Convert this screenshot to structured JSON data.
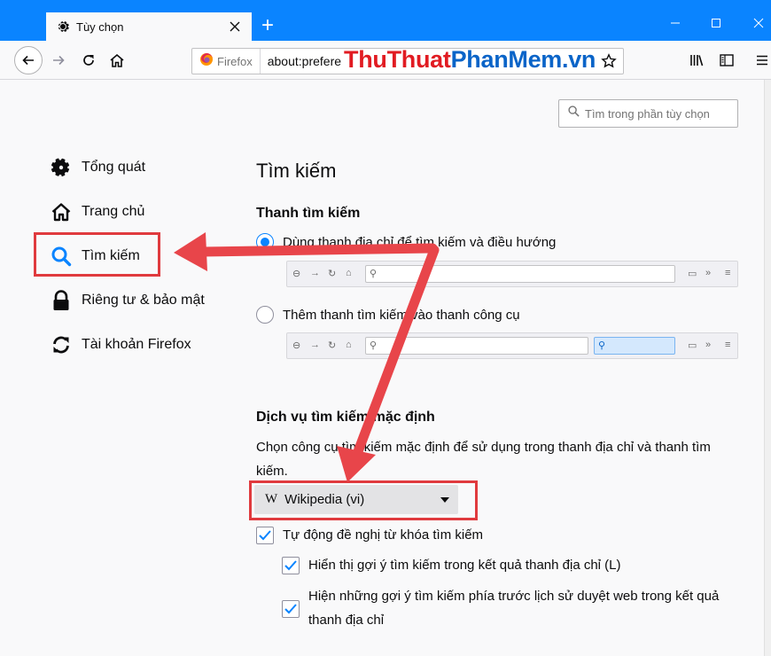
{
  "window": {
    "tab_title": "Tùy chọn",
    "new_tab": "+"
  },
  "navbar": {
    "identity_label": "Firefox",
    "url": "about:prefere",
    "watermark_a": "ThuThuat",
    "watermark_b": "PhanMem.vn"
  },
  "search_prefs": {
    "placeholder": "Tìm trong phần tùy chọn"
  },
  "categories": [
    {
      "label": "Tổng quát",
      "icon": "gear-icon"
    },
    {
      "label": "Trang chủ",
      "icon": "home-icon"
    },
    {
      "label": "Tìm kiếm",
      "icon": "search-icon",
      "selected": true
    },
    {
      "label": "Riêng tư & bảo mật",
      "icon": "lock-icon"
    },
    {
      "label": "Tài khoản Firefox",
      "icon": "sync-icon"
    }
  ],
  "main": {
    "heading": "Tìm kiếm",
    "search_bar_heading": "Thanh tìm kiếm",
    "option_urlbar": "Dùng thanh địa chỉ để tìm kiếm và điều hướng",
    "option_searchbar": "Thêm thanh tìm kiếm vào thanh công cụ",
    "default_engine_heading": "Dịch vụ tìm kiếm mặc định",
    "default_engine_desc": "Chọn công cụ tìm kiếm mặc định để sử dụng trong thanh địa chỉ và thanh tìm kiếm.",
    "engine_icon_text": "W",
    "engine_selected": "Wikipedia (vi)",
    "suggest_label": "Tự động đề nghị từ khóa tìm kiếm",
    "suggest_urlbar_label": "Hiển thị gợi ý tìm kiếm trong kết quả thanh địa chỉ (L)",
    "suggest_history_label": "Hiện những gợi ý tìm kiếm phía trước lịch sử duyệt web trong kết quả thanh địa chỉ"
  },
  "colors": {
    "accent": "#0a84ff",
    "annotation": "#e03a3e"
  }
}
